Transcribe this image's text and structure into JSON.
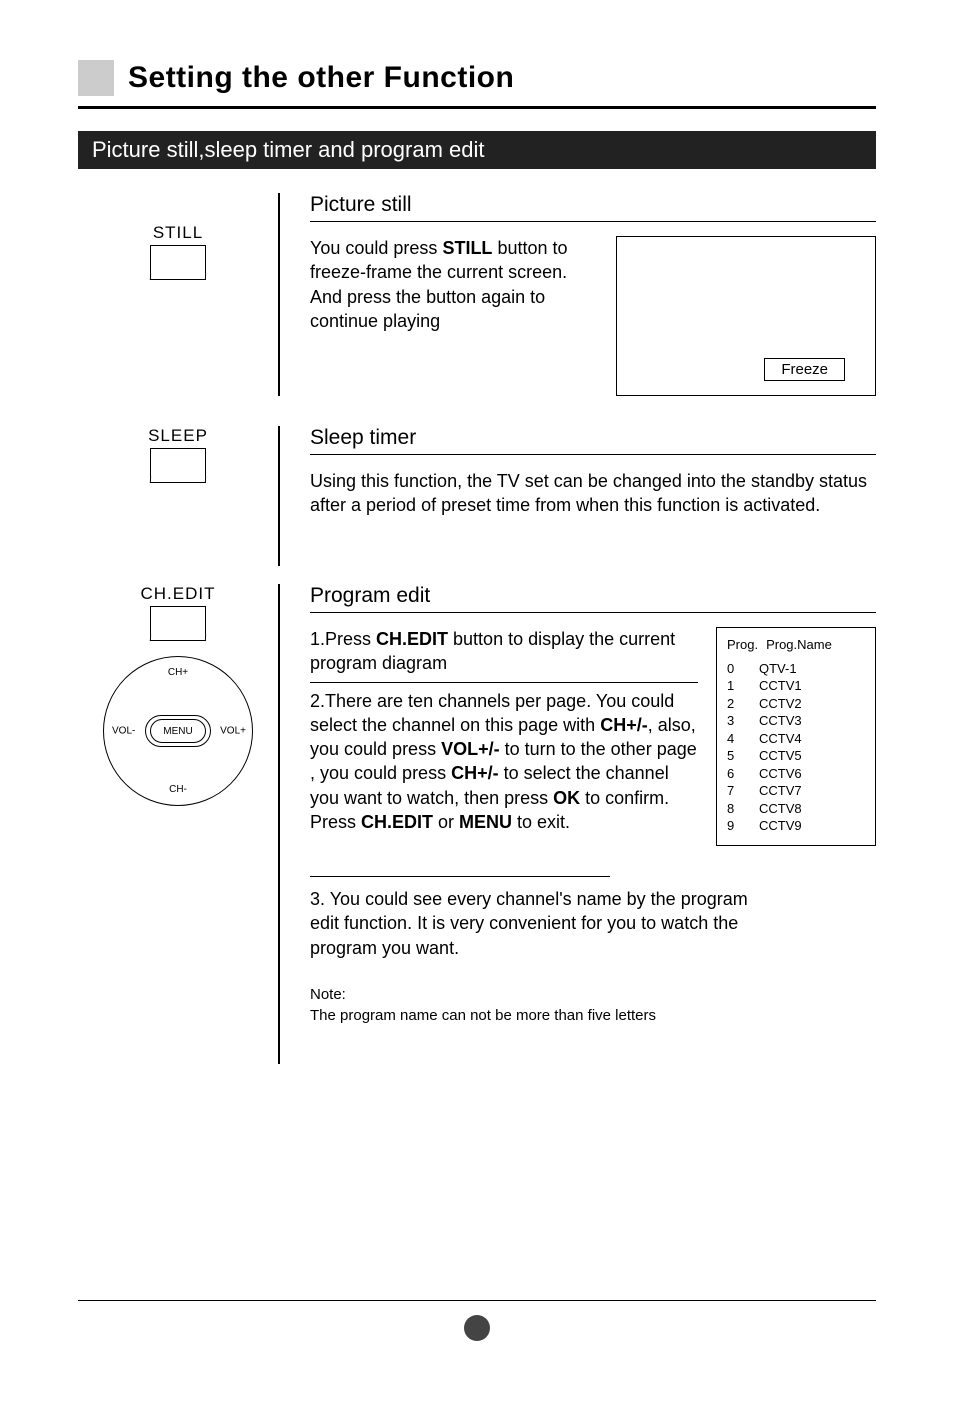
{
  "title": "Setting the other Function",
  "section_bar": "Picture still,sleep timer and program edit",
  "buttons": {
    "still": "STILL",
    "sleep": "SLEEP",
    "chedit": "CH.EDIT"
  },
  "dpad": {
    "up": "CH+",
    "down": "CH-",
    "left": "VOL-",
    "right": "VOL+",
    "center": "MENU"
  },
  "picture_still": {
    "heading": "Picture still",
    "text_pre": "You could press ",
    "text_bold": "STILL",
    "text_post": " button to freeze-frame the current screen. And press the button again to continue playing",
    "freeze_label": "Freeze"
  },
  "sleep_timer": {
    "heading": "Sleep timer",
    "text": "Using this function, the TV set can be changed into the standby status after a period of preset time from when this function is activated."
  },
  "program_edit": {
    "heading": "Program edit",
    "step1_pre": "1.Press ",
    "step1_bold": "CH.EDIT",
    "step1_post": " button to display the current program diagram",
    "step2_a": "2.There are ten channels per page. You could select the channel on this page with ",
    "step2_b1": "CH+/-",
    "step2_c": ", also, you could press ",
    "step2_b2": "VOL+/-",
    "step2_d": " to turn to the other page , you could press ",
    "step2_b3": "CH+/-",
    "step2_e": " to select the channel you want to watch, then press ",
    "step2_b4": "OK",
    "step2_f": " to confirm. Press ",
    "step2_b5": "CH.EDIT",
    "step2_g": " or ",
    "step2_b6": "MENU",
    "step2_h": " to exit.",
    "step3": "3. You could see every channel's name by the program edit function. It is very convenient for you to watch the program you want.",
    "note_label": "Note:",
    "note_text": "The program name can not be more than five letters",
    "table_header_1": "Prog.",
    "table_header_2": "Prog.Name",
    "channels": [
      {
        "num": "0",
        "name": "QTV-1"
      },
      {
        "num": "1",
        "name": "CCTV1"
      },
      {
        "num": "2",
        "name": "CCTV2"
      },
      {
        "num": "3",
        "name": "CCTV3"
      },
      {
        "num": "4",
        "name": "CCTV4"
      },
      {
        "num": "5",
        "name": "CCTV5"
      },
      {
        "num": "6",
        "name": "CCTV6"
      },
      {
        "num": "7",
        "name": "CCTV7"
      },
      {
        "num": "8",
        "name": "CCTV8"
      },
      {
        "num": "9",
        "name": "CCTV9"
      }
    ]
  }
}
